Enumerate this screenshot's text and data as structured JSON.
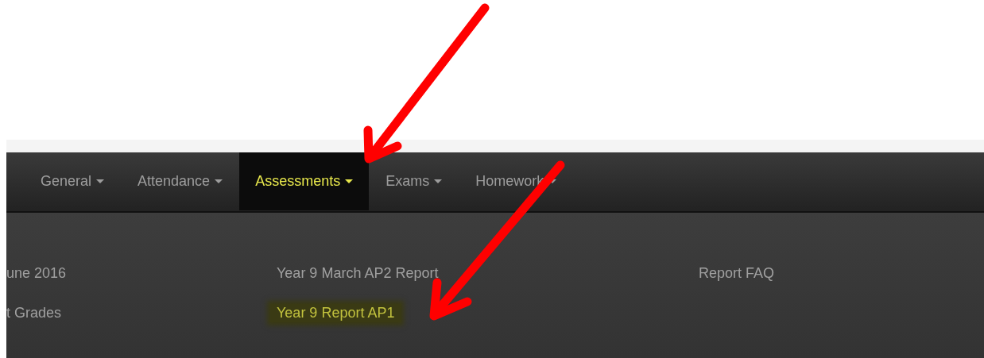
{
  "navbar": {
    "items": [
      {
        "label": "General",
        "selected": false
      },
      {
        "label": "Attendance",
        "selected": false
      },
      {
        "label": "Assessments",
        "selected": true
      },
      {
        "label": "Exams",
        "selected": false
      },
      {
        "label": "Homework",
        "selected": false
      }
    ]
  },
  "dropdown": {
    "columns": [
      [
        {
          "label": "une 2016",
          "selected": false
        },
        {
          "label": "t Grades",
          "selected": false
        }
      ],
      [
        {
          "label": "Year 9 March AP2 Report",
          "selected": false
        },
        {
          "label": "Year 9 Report AP1",
          "selected": true
        }
      ],
      [
        {
          "label": "Report FAQ",
          "selected": false
        }
      ]
    ]
  },
  "annotations": [
    {
      "kind": "arrow"
    },
    {
      "kind": "arrow"
    }
  ]
}
